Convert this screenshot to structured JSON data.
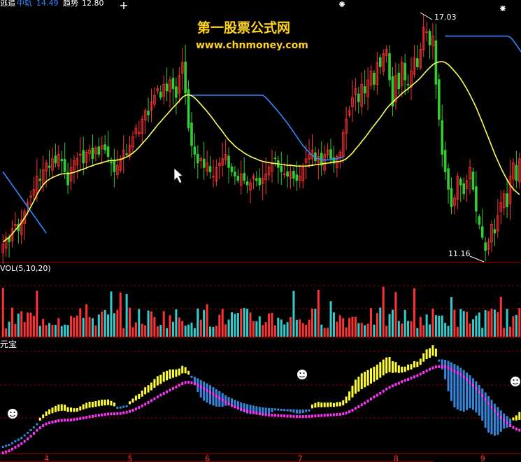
{
  "header": {
    "label_a": "逃追",
    "label_b": "中轨",
    "value_b": "14.49",
    "label_c": "趋势",
    "value_c": "12.80"
  },
  "watermark": {
    "line1": "第一股票公式网",
    "line2": "www.chnmoney.com"
  },
  "annotations": {
    "high_label": "17.03",
    "low_label": "11.16"
  },
  "volume_panel": {
    "title": "VOL(5,10,20)"
  },
  "indicator_panel": {
    "title": "元宝"
  },
  "x_axis": {
    "ticks": [
      "4",
      "5",
      "6",
      "7",
      "8",
      "9"
    ]
  },
  "colors": {
    "up": "#ff3333",
    "down": "#33cc33",
    "yellow_line": "#ffff55",
    "blue_line": "#3388ff",
    "vol_up": "#ff3333",
    "vol_down": "#33cccc",
    "magenta": "#ff33ff",
    "grid": "#880000"
  },
  "chart_data": {
    "type": "candlestick",
    "price_range": [
      11.16,
      17.03
    ],
    "close": [
      11.55,
      11.7,
      11.6,
      11.9,
      12.0,
      11.85,
      12.1,
      12.3,
      12.5,
      12.65,
      12.8,
      13.1,
      13.0,
      13.25,
      13.4,
      13.3,
      13.5,
      13.4,
      13.6,
      13.45,
      13.2,
      12.9,
      13.3,
      13.45,
      13.5,
      13.6,
      13.4,
      13.65,
      13.7,
      13.5,
      13.75,
      13.6,
      13.8,
      13.7,
      13.55,
      13.4,
      13.2,
      13.35,
      13.5,
      13.7,
      13.6,
      13.8,
      14.0,
      14.2,
      14.1,
      14.4,
      14.6,
      14.5,
      14.8,
      14.95,
      15.1,
      14.9,
      15.2,
      15.05,
      15.3,
      15.1,
      14.9,
      15.4,
      15.7,
      15.0,
      14.2,
      13.8,
      13.6,
      13.4,
      13.5,
      13.3,
      13.4,
      13.2,
      13.1,
      13.3,
      13.4,
      13.5,
      13.6,
      13.3,
      13.2,
      13.1,
      13.0,
      13.15,
      13.0,
      12.9,
      12.95,
      13.1,
      13.0,
      12.9,
      13.05,
      13.15,
      13.3,
      13.4,
      13.5,
      13.3,
      13.2,
      13.15,
      13.1,
      13.2,
      13.05,
      13.0,
      13.1,
      13.3,
      13.5,
      13.6,
      13.7,
      13.45,
      13.55,
      13.35,
      13.6,
      13.7,
      13.5,
      13.4,
      13.55,
      13.65,
      14.1,
      14.4,
      14.6,
      14.9,
      15.1,
      14.8,
      15.2,
      15.0,
      15.3,
      15.5,
      15.2,
      15.7,
      15.6,
      15.9,
      16.0,
      15.3,
      14.7,
      15.4,
      15.1,
      15.7,
      15.3,
      15.2,
      15.5,
      15.8,
      15.6,
      16.0,
      16.5,
      16.4,
      16.1,
      16.3,
      15.2,
      14.4,
      13.6,
      13.2,
      12.8,
      12.4,
      12.6,
      13.1,
      12.9,
      12.7,
      13.0,
      13.3,
      12.8,
      12.3,
      12.0,
      11.7,
      11.4,
      11.6,
      12.0,
      11.8,
      12.2,
      12.5,
      12.7,
      12.4,
      13.1,
      13.4,
      13.0,
      13.5
    ],
    "yellow_line": [
      11.6,
      11.65,
      11.7,
      11.78,
      11.87,
      11.95,
      12.04,
      12.15,
      12.27,
      12.4,
      12.53,
      12.68,
      12.8,
      12.9,
      12.98,
      13.03,
      13.07,
      13.1,
      13.13,
      13.15,
      13.16,
      13.16,
      13.17,
      13.19,
      13.21,
      13.24,
      13.26,
      13.29,
      13.32,
      13.34,
      13.37,
      13.39,
      13.41,
      13.43,
      13.45,
      13.46,
      13.46,
      13.47,
      13.48,
      13.51,
      13.54,
      13.58,
      13.63,
      13.69,
      13.76,
      13.84,
      13.92,
      14.0,
      14.09,
      14.18,
      14.27,
      14.35,
      14.43,
      14.51,
      14.59,
      14.67,
      14.74,
      14.82,
      14.9,
      14.95,
      14.96,
      14.94,
      14.89,
      14.82,
      14.74,
      14.66,
      14.58,
      14.49,
      14.4,
      14.3,
      14.21,
      14.12,
      14.02,
      13.93,
      13.86,
      13.79,
      13.73,
      13.68,
      13.63,
      13.59,
      13.55,
      13.52,
      13.49,
      13.46,
      13.44,
      13.42,
      13.41,
      13.4,
      13.39,
      13.38,
      13.37,
      13.36,
      13.35,
      13.35,
      13.34,
      13.33,
      13.33,
      13.33,
      13.33,
      13.34,
      13.35,
      13.36,
      13.37,
      13.38,
      13.39,
      13.4,
      13.41,
      13.42,
      13.43,
      13.44,
      13.46,
      13.5,
      13.56,
      13.63,
      13.72,
      13.8,
      13.89,
      13.98,
      14.07,
      14.17,
      14.26,
      14.35,
      14.44,
      14.54,
      14.64,
      14.72,
      14.79,
      14.86,
      14.92,
      14.99,
      15.05,
      15.1,
      15.16,
      15.22,
      15.28,
      15.35,
      15.43,
      15.51,
      15.58,
      15.65,
      15.69,
      15.71,
      15.72,
      15.7,
      15.65,
      15.58,
      15.5,
      15.42,
      15.32,
      15.21,
      15.09,
      14.96,
      14.82,
      14.67,
      14.5,
      14.33,
      14.15,
      13.97,
      13.79,
      13.61,
      13.45,
      13.29,
      13.15,
      13.02,
      12.9,
      12.81,
      12.74,
      12.68
    ],
    "blue_line": [
      13.2,
      13.1,
      13.0,
      12.9,
      12.8,
      12.7,
      12.6,
      12.5,
      12.4,
      12.3,
      12.2,
      12.1,
      12.0,
      11.9,
      11.8,
      null,
      null,
      null,
      null,
      null,
      null,
      null,
      null,
      null,
      null,
      null,
      null,
      null,
      null,
      null,
      null,
      null,
      null,
      null,
      null,
      null,
      null,
      null,
      null,
      null,
      null,
      null,
      null,
      null,
      null,
      null,
      null,
      null,
      null,
      null,
      null,
      null,
      null,
      null,
      null,
      null,
      null,
      null,
      null,
      14.95,
      14.95,
      14.95,
      14.95,
      14.95,
      14.95,
      14.95,
      14.95,
      14.95,
      14.95,
      14.95,
      14.95,
      14.95,
      14.95,
      14.95,
      14.95,
      14.95,
      14.95,
      14.95,
      14.95,
      14.95,
      14.95,
      14.95,
      14.95,
      14.95,
      14.95,
      14.9,
      14.82,
      14.74,
      14.66,
      14.58,
      14.49,
      14.4,
      14.31,
      14.21,
      14.11,
      14.0,
      13.9,
      13.8,
      13.72,
      13.64,
      13.58,
      13.53,
      13.5,
      13.48,
      13.47,
      13.47,
      13.48,
      13.49,
      13.5,
      13.52,
      13.54,
      null,
      null,
      null,
      null,
      null,
      null,
      null,
      null,
      null,
      null,
      null,
      null,
      null,
      null,
      null,
      null,
      null,
      null,
      null,
      null,
      null,
      null,
      null,
      null,
      null,
      null,
      null,
      null,
      null,
      null,
      null,
      null,
      16.3,
      16.3,
      16.3,
      16.3,
      16.3,
      16.3,
      16.3,
      16.3,
      16.3,
      16.3,
      16.3,
      16.3,
      16.3,
      16.3,
      16.3,
      16.3,
      16.3,
      16.3,
      16.3,
      16.3,
      16.3,
      16.28,
      16.2,
      16.1,
      16.0,
      15.9,
      15.8,
      15.7,
      15.6,
      15.5,
      15.4,
      15.3,
      15.2,
      15.1,
      15.0,
      14.9,
      14.8
    ]
  }
}
